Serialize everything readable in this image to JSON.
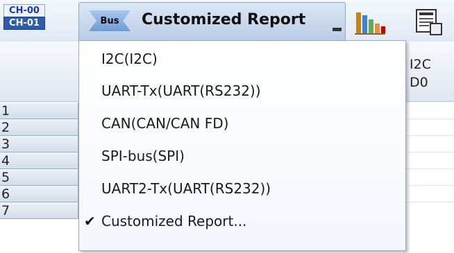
{
  "toolbar": {
    "channels": {
      "top": "CH-00",
      "bottom": "CH-01"
    },
    "bus_icon_label": "Bus",
    "selected_report": "Customized Report",
    "icons": {
      "chart": "bar-chart-icon",
      "report": "report-export-icon",
      "caret": "dropdown-caret-icon"
    }
  },
  "grid": {
    "right_col_header_lines": [
      "I2C",
      "D0"
    ],
    "rows": [
      "1",
      "2",
      "3",
      "4",
      "5",
      "6",
      "7"
    ]
  },
  "menu": {
    "items": [
      {
        "label": "I2C(I2C)",
        "checked": false
      },
      {
        "label": "UART-Tx(UART(RS232))",
        "checked": false
      },
      {
        "label": "CAN(CAN/CAN FD)",
        "checked": false
      },
      {
        "label": "SPI-bus(SPI)",
        "checked": false
      },
      {
        "label": "UART2-Tx(UART(RS232))",
        "checked": false
      },
      {
        "label": "Customized Report...",
        "checked": true
      }
    ],
    "check_glyph": "✔"
  },
  "colors": {
    "channel_blue": "#2f5ca8",
    "toolbar_bg": "#dfe9f5",
    "chart_bars": [
      "#6aa84f",
      "#e69138",
      "#e8b23a",
      "#3d85c6",
      "#cc0000"
    ]
  }
}
